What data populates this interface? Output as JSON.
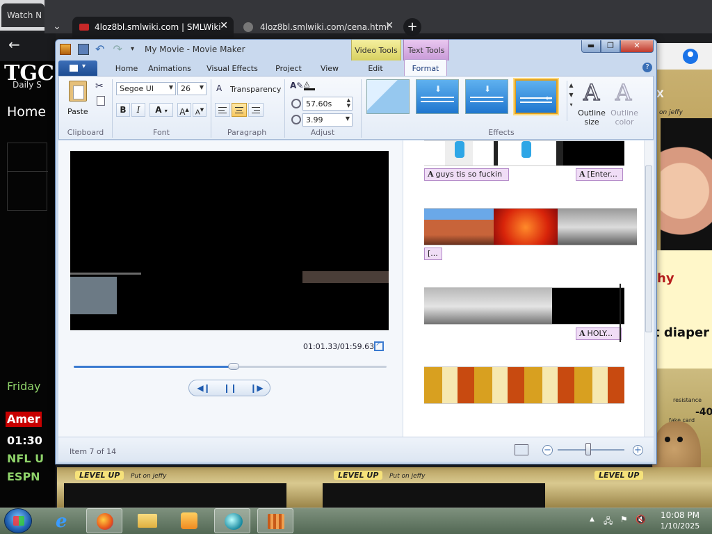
{
  "background_browser": {
    "left_tab_title": "Watch N",
    "active_tab_title": "4loz8bl.smlwiki.com | SMLWiki",
    "second_tab_title": "4loz8bl.smlwiki.com/cena.html",
    "site_logo": "TGC",
    "site_logo_sub": "Daily S",
    "nav_home": "Home",
    "friday_text": "Friday",
    "headline_badge": "Amer",
    "time_text": "01:30",
    "nfl_text": "NFL U",
    "espn_text": "ESPN",
    "meme_x": "X",
    "meme_on_jeffy": "on jeffy",
    "meme_hy": "hy",
    "meme_diaper": "t diaper",
    "resistance_text": "resistance",
    "minus_40": "-40",
    "fake_card_text": "fake card",
    "level_up_text": "LEVEL UP",
    "put_on_jeffy": "Put on jeffy"
  },
  "window": {
    "title": "My Movie - Movie Maker",
    "context_video_tools": "Video Tools",
    "context_text_tools": "Text Tools",
    "min_glyph": "▬",
    "max_glyph": "❐",
    "close_glyph": "✕"
  },
  "ribbon_tabs": [
    {
      "label": "Home"
    },
    {
      "label": "Animations"
    },
    {
      "label": "Visual Effects"
    },
    {
      "label": "Project"
    },
    {
      "label": "View"
    },
    {
      "label": "Edit"
    },
    {
      "label": "Format",
      "active": true
    }
  ],
  "ribbon": {
    "clipboard": {
      "paste_label": "Paste",
      "group_label": "Clipboard"
    },
    "font": {
      "family": "Segoe UI",
      "size": "26",
      "bold": "B",
      "italic": "I",
      "color_letter": "A",
      "grow": "A",
      "shrink": "A",
      "group_label": "Font"
    },
    "paragraph": {
      "transparency_label": "Transparency",
      "group_label": "Paragraph"
    },
    "adjust": {
      "start_time": "57.60s",
      "text_duration": "3.99",
      "group_label": "Adjust"
    },
    "effects": {
      "group_label": "Effects",
      "selected_index": 3
    },
    "outline_size_label": "Outline size",
    "outline_color_label": "Outline color"
  },
  "preview": {
    "timecode": "01:01.33/01:59.63",
    "seek_progress": 0.51
  },
  "storyboard": {
    "captions": [
      "guys tis so fuckin",
      "[Enter...",
      "[...",
      "HOLY..."
    ]
  },
  "status": {
    "text": "Item 7 of 14",
    "zoom_minus": "−",
    "zoom_plus": "+"
  },
  "taskbar": {
    "time": "10:08 PM",
    "date": "1/10/2025"
  },
  "colors": {
    "ribbon_accent": "#3a6fb6",
    "text_tools_tab": "#d6b0e4",
    "video_tools_tab": "#eee58c"
  }
}
